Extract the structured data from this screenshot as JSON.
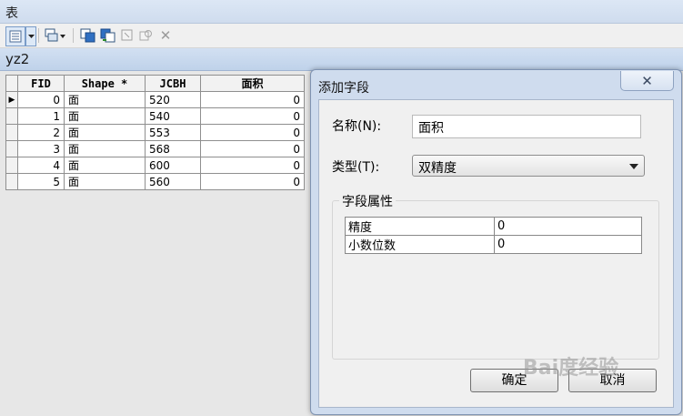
{
  "window": {
    "title": "表"
  },
  "toolbar": {
    "icons": [
      "table-options-icon",
      "dropdown-arrow-icon",
      "related-tables-icon",
      "select-by-attributes-icon",
      "switch-selection-icon",
      "clear-selection-icon",
      "zoom-to-selected-icon",
      "delete-selected-icon"
    ]
  },
  "tab": {
    "name": "yz2"
  },
  "table": {
    "columns": [
      "FID",
      "Shape *",
      "JCBH",
      "面积"
    ],
    "rows": [
      {
        "fid": "0",
        "shape": "面",
        "jcbh": "520",
        "area": "0"
      },
      {
        "fid": "1",
        "shape": "面",
        "jcbh": "540",
        "area": "0"
      },
      {
        "fid": "2",
        "shape": "面",
        "jcbh": "553",
        "area": "0"
      },
      {
        "fid": "3",
        "shape": "面",
        "jcbh": "568",
        "area": "0"
      },
      {
        "fid": "4",
        "shape": "面",
        "jcbh": "600",
        "area": "0"
      },
      {
        "fid": "5",
        "shape": "面",
        "jcbh": "560",
        "area": "0"
      }
    ]
  },
  "dialog": {
    "title": "添加字段",
    "close_glyph": "✕",
    "name_label": "名称(N):",
    "name_value": "面积",
    "type_label": "类型(T):",
    "type_value": "双精度",
    "group_label": "字段属性",
    "properties": [
      {
        "key": "精度",
        "value": "0"
      },
      {
        "key": "小数位数",
        "value": "0"
      }
    ],
    "ok_label": "确定",
    "cancel_label": "取消"
  },
  "watermark": "Bai度经验"
}
